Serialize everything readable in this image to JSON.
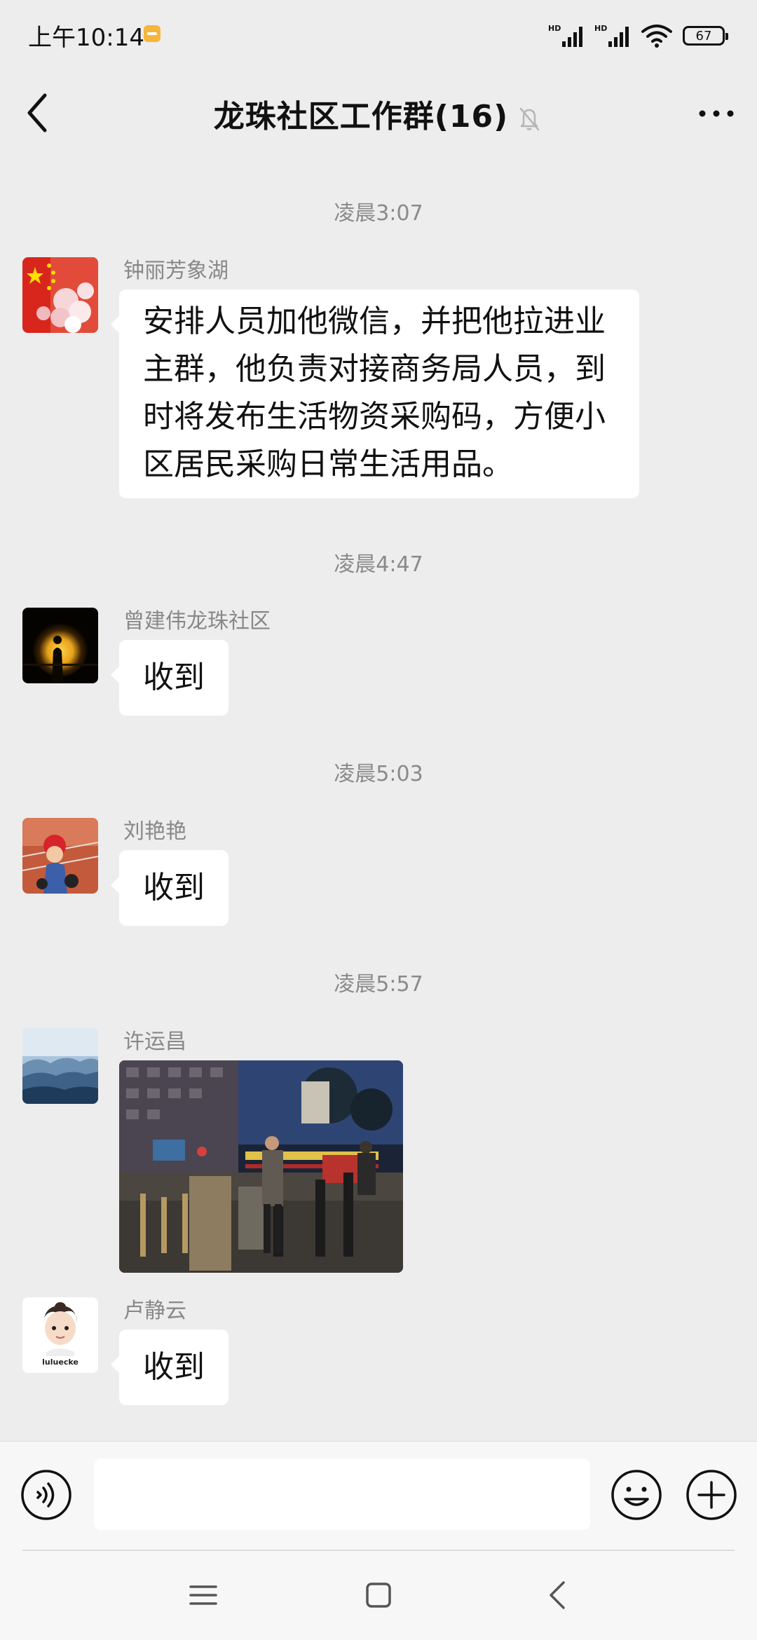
{
  "status_bar": {
    "time": "上午10:14",
    "network1": "HD",
    "network2": "HD",
    "battery": "67"
  },
  "header": {
    "title": "龙珠社区工作群(16)"
  },
  "messages": [
    {
      "timestamp": "凌晨3:07",
      "sender": "钟丽芳象湖",
      "text_lines": [
        "安排人员加他微信，并把他拉进业",
        "主群，他负责对接商务局人员，到",
        "时将发布生活物资采购码，方便小",
        "区居民采购日常生活用品。"
      ]
    },
    {
      "timestamp": "凌晨4:47",
      "sender": "曾建伟龙珠社区",
      "text": "收到"
    },
    {
      "timestamp": "凌晨5:03",
      "sender": "刘艳艳",
      "text": "收到"
    },
    {
      "timestamp": "凌晨5:57",
      "sender": "许运昌",
      "image": "night-street-gate-photo"
    },
    {
      "sender": "卢静云",
      "avatar_text": "luluecke",
      "text": "收到"
    }
  ],
  "input_bar": {
    "placeholder": ""
  },
  "colors": {
    "background": "#ededed",
    "bubble": "#ffffff",
    "timestamp": "#8a8a8a",
    "sender": "#888888"
  },
  "icons": {
    "back": "back-arrow-icon",
    "mute": "mute-bell-icon",
    "more": "more-dots-icon",
    "voice": "voice-icon",
    "emoji": "emoji-icon",
    "plus": "plus-icon",
    "nav_menu": "menu-icon",
    "nav_home": "home-square-icon",
    "nav_back": "back-triangle-icon"
  }
}
